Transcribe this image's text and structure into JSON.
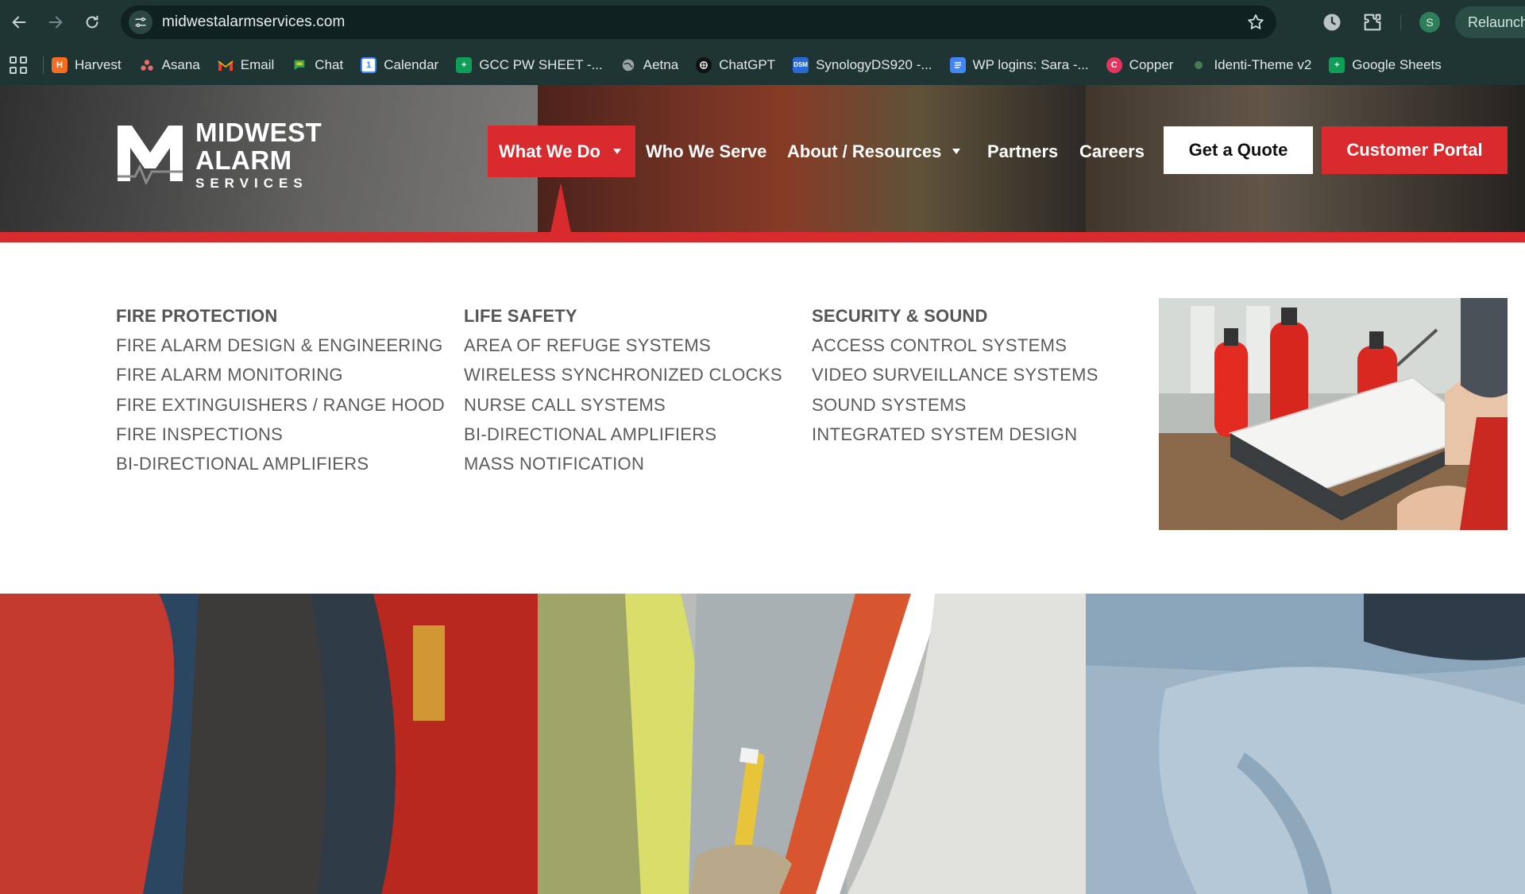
{
  "browser": {
    "url": "midwestalarmservices.com",
    "profile_initial": "S",
    "relaunch_label": "Relaunch"
  },
  "bookmarks": [
    {
      "label": "Harvest",
      "icon": "harvest-icon",
      "color": "#f36c21"
    },
    {
      "label": "Asana",
      "icon": "asana-icon",
      "color": "#f06a6a"
    },
    {
      "label": "Email",
      "icon": "gmail-icon",
      "color": "#ea4335"
    },
    {
      "label": "Chat",
      "icon": "chat-icon",
      "color": "#34a853"
    },
    {
      "label": "Calendar",
      "icon": "calendar-icon",
      "color": "#4285f4"
    },
    {
      "label": "GCC PW SHEET -...",
      "icon": "sheets-icon",
      "color": "#0f9d58"
    },
    {
      "label": "Aetna",
      "icon": "globe-icon",
      "color": "#9aa5a4"
    },
    {
      "label": "ChatGPT",
      "icon": "chatgpt-icon",
      "color": "#111111"
    },
    {
      "label": "SynologyDS920 -...",
      "icon": "synology-icon",
      "color": "#2a6ad6"
    },
    {
      "label": "WP logins: Sara -...",
      "icon": "docs-icon",
      "color": "#4285f4"
    },
    {
      "label": "Copper",
      "icon": "copper-icon",
      "color": "#e8335f"
    },
    {
      "label": "Identi-Theme v2",
      "icon": "leaf-icon",
      "color": "#4a7a52"
    },
    {
      "label": "Google Sheets",
      "icon": "sheets-icon",
      "color": "#0f9d58"
    }
  ],
  "site": {
    "logo": {
      "line1": "MIDWEST",
      "line2": "ALARM",
      "line3": "SERVICES"
    },
    "nav": {
      "what_we_do": "What We Do",
      "who_we_serve": "Who We Serve",
      "about": "About / Resources",
      "partners": "Partners",
      "careers": "Careers"
    },
    "quote_label": "Get a Quote",
    "portal_label": "Customer Portal",
    "colors": {
      "brand_red": "#d92a2e"
    }
  },
  "mega_menu": {
    "columns": [
      {
        "title": "FIRE PROTECTION",
        "items": [
          "FIRE ALARM DESIGN & ENGINEERING",
          "FIRE ALARM MONITORING",
          "FIRE EXTINGUISHERS / RANGE HOOD",
          "FIRE INSPECTIONS",
          "BI-DIRECTIONAL AMPLIFIERS"
        ]
      },
      {
        "title": "LIFE SAFETY",
        "items": [
          "AREA OF REFUGE SYSTEMS",
          "WIRELESS SYNCHRONIZED CLOCKS",
          "NURSE CALL SYSTEMS",
          "BI-DIRECTIONAL AMPLIFIERS",
          "MASS NOTIFICATION"
        ]
      },
      {
        "title": "SECURITY & SOUND",
        "items": [
          "ACCESS CONTROL SYSTEMS",
          "VIDEO SURVEILLANCE SYSTEMS",
          "SOUND SYSTEMS",
          "INTEGRATED SYSTEM DESIGN"
        ]
      }
    ]
  }
}
